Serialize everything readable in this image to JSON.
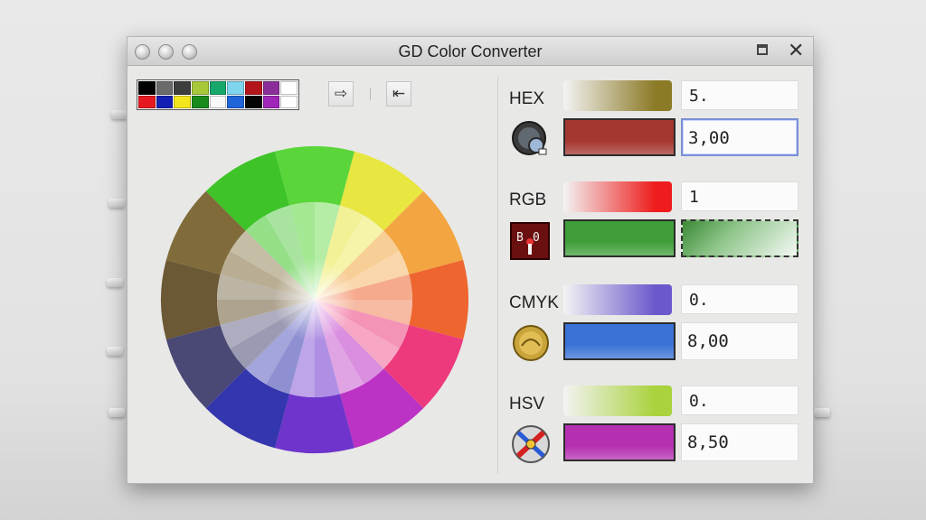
{
  "window": {
    "title": "GD Color Converter"
  },
  "palette": {
    "colors": [
      "#000000",
      "#6b6b6b",
      "#3d3d3d",
      "#a8c83a",
      "#16a86a",
      "#7fd4ee",
      "#b4151b",
      "#8a2f9a",
      "#ffffff",
      "#e81820",
      "#1420b4",
      "#f4e61c",
      "#198a1c",
      "#f8f8f8",
      "#1f64d8",
      "#050505",
      "#9f26b8",
      "#ffffff"
    ]
  },
  "toolbar": {
    "forward_icon": "arrow-right-icon",
    "back_icon": "arrow-left-icon"
  },
  "wheel": {
    "outer_colors": [
      "#5ad63a",
      "#e8e640",
      "#f3a542",
      "#ee6530",
      "#ed3a7c",
      "#bb32c4",
      "#6e34cc",
      "#3436ae",
      "#4a4874",
      "#6b5834",
      "#7f6c3a",
      "#3ec429"
    ],
    "center_color": "#ffffff"
  },
  "sections": [
    {
      "label": "HEX",
      "strip_color": "#8b7a26",
      "top_value": "5.",
      "swatch_color": "#a4372f",
      "bottom_value": "3,00",
      "icon": "gauge-icon"
    },
    {
      "label": "RGB",
      "strip_color": "#ee1c1c",
      "top_value": "1",
      "swatch_color": "#3f9e3a",
      "bottom_value": "",
      "icon": "calendar-icon"
    },
    {
      "label": "CMYK",
      "strip_color": "#6a58cc",
      "top_value": "0.",
      "swatch_color": "#3a72d6",
      "bottom_value": "8,00",
      "icon": "gold-coin-icon"
    },
    {
      "label": "HSV",
      "strip_color": "#a9d23c",
      "top_value": "0.",
      "swatch_color": "#b530b0",
      "bottom_value": "8,50",
      "icon": "tools-icon"
    }
  ]
}
